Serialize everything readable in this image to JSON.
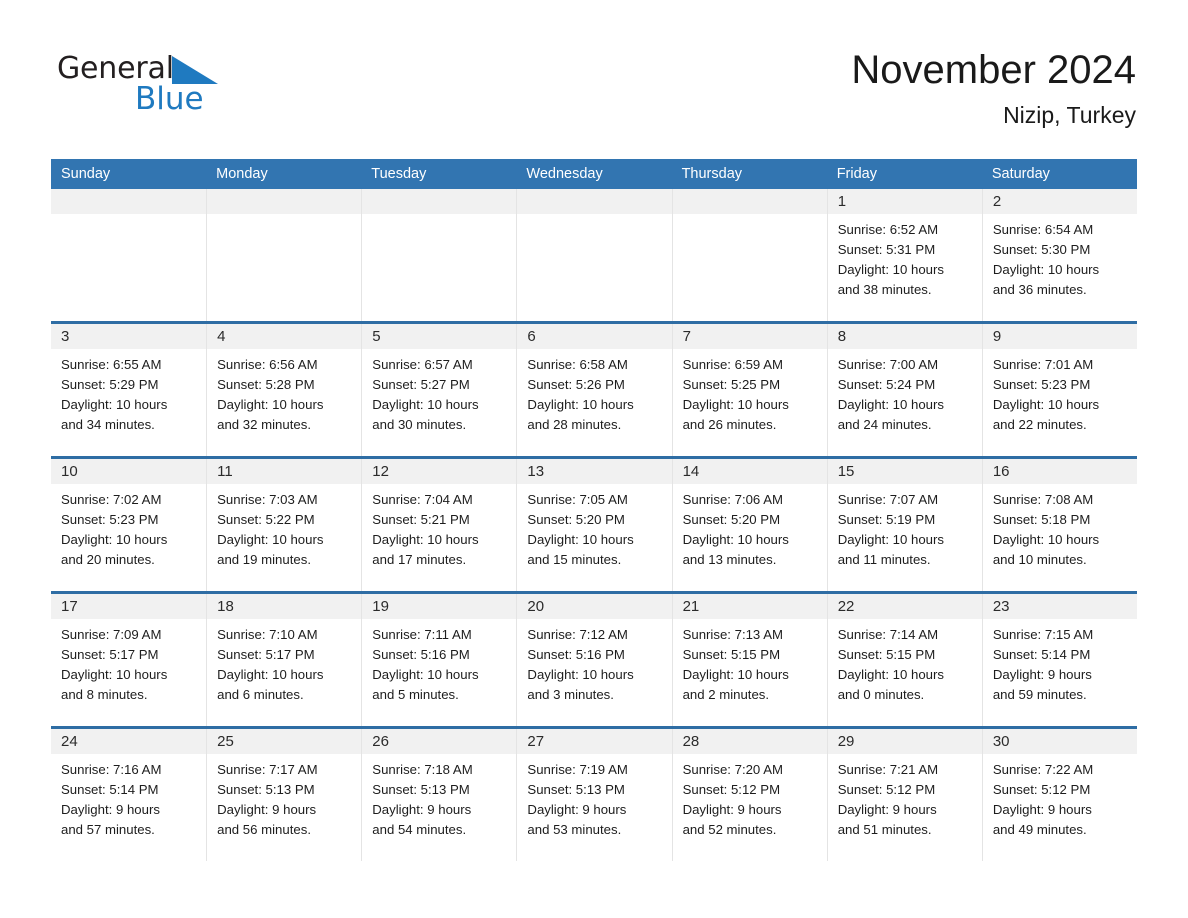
{
  "brand": {
    "name_part1": "General",
    "name_part2": "Blue",
    "triangle_color": "#1f7ac0"
  },
  "header": {
    "title": "November 2024",
    "subtitle": "Nizip, Turkey"
  },
  "theme": {
    "header_blue": "#3275b1",
    "week_divider_blue": "#2e6da4",
    "day_band_gray": "#f1f1f1",
    "text_color": "#1d1d1d"
  },
  "weekdays": [
    "Sunday",
    "Monday",
    "Tuesday",
    "Wednesday",
    "Thursday",
    "Friday",
    "Saturday"
  ],
  "weeks": [
    [
      {
        "empty": true
      },
      {
        "empty": true
      },
      {
        "empty": true
      },
      {
        "empty": true
      },
      {
        "empty": true
      },
      {
        "day": "1",
        "sunrise": "Sunrise: 6:52 AM",
        "sunset": "Sunset: 5:31 PM",
        "daylight1": "Daylight: 10 hours",
        "daylight2": "and 38 minutes."
      },
      {
        "day": "2",
        "sunrise": "Sunrise: 6:54 AM",
        "sunset": "Sunset: 5:30 PM",
        "daylight1": "Daylight: 10 hours",
        "daylight2": "and 36 minutes."
      }
    ],
    [
      {
        "day": "3",
        "sunrise": "Sunrise: 6:55 AM",
        "sunset": "Sunset: 5:29 PM",
        "daylight1": "Daylight: 10 hours",
        "daylight2": "and 34 minutes."
      },
      {
        "day": "4",
        "sunrise": "Sunrise: 6:56 AM",
        "sunset": "Sunset: 5:28 PM",
        "daylight1": "Daylight: 10 hours",
        "daylight2": "and 32 minutes."
      },
      {
        "day": "5",
        "sunrise": "Sunrise: 6:57 AM",
        "sunset": "Sunset: 5:27 PM",
        "daylight1": "Daylight: 10 hours",
        "daylight2": "and 30 minutes."
      },
      {
        "day": "6",
        "sunrise": "Sunrise: 6:58 AM",
        "sunset": "Sunset: 5:26 PM",
        "daylight1": "Daylight: 10 hours",
        "daylight2": "and 28 minutes."
      },
      {
        "day": "7",
        "sunrise": "Sunrise: 6:59 AM",
        "sunset": "Sunset: 5:25 PM",
        "daylight1": "Daylight: 10 hours",
        "daylight2": "and 26 minutes."
      },
      {
        "day": "8",
        "sunrise": "Sunrise: 7:00 AM",
        "sunset": "Sunset: 5:24 PM",
        "daylight1": "Daylight: 10 hours",
        "daylight2": "and 24 minutes."
      },
      {
        "day": "9",
        "sunrise": "Sunrise: 7:01 AM",
        "sunset": "Sunset: 5:23 PM",
        "daylight1": "Daylight: 10 hours",
        "daylight2": "and 22 minutes."
      }
    ],
    [
      {
        "day": "10",
        "sunrise": "Sunrise: 7:02 AM",
        "sunset": "Sunset: 5:23 PM",
        "daylight1": "Daylight: 10 hours",
        "daylight2": "and 20 minutes."
      },
      {
        "day": "11",
        "sunrise": "Sunrise: 7:03 AM",
        "sunset": "Sunset: 5:22 PM",
        "daylight1": "Daylight: 10 hours",
        "daylight2": "and 19 minutes."
      },
      {
        "day": "12",
        "sunrise": "Sunrise: 7:04 AM",
        "sunset": "Sunset: 5:21 PM",
        "daylight1": "Daylight: 10 hours",
        "daylight2": "and 17 minutes."
      },
      {
        "day": "13",
        "sunrise": "Sunrise: 7:05 AM",
        "sunset": "Sunset: 5:20 PM",
        "daylight1": "Daylight: 10 hours",
        "daylight2": "and 15 minutes."
      },
      {
        "day": "14",
        "sunrise": "Sunrise: 7:06 AM",
        "sunset": "Sunset: 5:20 PM",
        "daylight1": "Daylight: 10 hours",
        "daylight2": "and 13 minutes."
      },
      {
        "day": "15",
        "sunrise": "Sunrise: 7:07 AM",
        "sunset": "Sunset: 5:19 PM",
        "daylight1": "Daylight: 10 hours",
        "daylight2": "and 11 minutes."
      },
      {
        "day": "16",
        "sunrise": "Sunrise: 7:08 AM",
        "sunset": "Sunset: 5:18 PM",
        "daylight1": "Daylight: 10 hours",
        "daylight2": "and 10 minutes."
      }
    ],
    [
      {
        "day": "17",
        "sunrise": "Sunrise: 7:09 AM",
        "sunset": "Sunset: 5:17 PM",
        "daylight1": "Daylight: 10 hours",
        "daylight2": "and 8 minutes."
      },
      {
        "day": "18",
        "sunrise": "Sunrise: 7:10 AM",
        "sunset": "Sunset: 5:17 PM",
        "daylight1": "Daylight: 10 hours",
        "daylight2": "and 6 minutes."
      },
      {
        "day": "19",
        "sunrise": "Sunrise: 7:11 AM",
        "sunset": "Sunset: 5:16 PM",
        "daylight1": "Daylight: 10 hours",
        "daylight2": "and 5 minutes."
      },
      {
        "day": "20",
        "sunrise": "Sunrise: 7:12 AM",
        "sunset": "Sunset: 5:16 PM",
        "daylight1": "Daylight: 10 hours",
        "daylight2": "and 3 minutes."
      },
      {
        "day": "21",
        "sunrise": "Sunrise: 7:13 AM",
        "sunset": "Sunset: 5:15 PM",
        "daylight1": "Daylight: 10 hours",
        "daylight2": "and 2 minutes."
      },
      {
        "day": "22",
        "sunrise": "Sunrise: 7:14 AM",
        "sunset": "Sunset: 5:15 PM",
        "daylight1": "Daylight: 10 hours",
        "daylight2": "and 0 minutes."
      },
      {
        "day": "23",
        "sunrise": "Sunrise: 7:15 AM",
        "sunset": "Sunset: 5:14 PM",
        "daylight1": "Daylight: 9 hours",
        "daylight2": "and 59 minutes."
      }
    ],
    [
      {
        "day": "24",
        "sunrise": "Sunrise: 7:16 AM",
        "sunset": "Sunset: 5:14 PM",
        "daylight1": "Daylight: 9 hours",
        "daylight2": "and 57 minutes."
      },
      {
        "day": "25",
        "sunrise": "Sunrise: 7:17 AM",
        "sunset": "Sunset: 5:13 PM",
        "daylight1": "Daylight: 9 hours",
        "daylight2": "and 56 minutes."
      },
      {
        "day": "26",
        "sunrise": "Sunrise: 7:18 AM",
        "sunset": "Sunset: 5:13 PM",
        "daylight1": "Daylight: 9 hours",
        "daylight2": "and 54 minutes."
      },
      {
        "day": "27",
        "sunrise": "Sunrise: 7:19 AM",
        "sunset": "Sunset: 5:13 PM",
        "daylight1": "Daylight: 9 hours",
        "daylight2": "and 53 minutes."
      },
      {
        "day": "28",
        "sunrise": "Sunrise: 7:20 AM",
        "sunset": "Sunset: 5:12 PM",
        "daylight1": "Daylight: 9 hours",
        "daylight2": "and 52 minutes."
      },
      {
        "day": "29",
        "sunrise": "Sunrise: 7:21 AM",
        "sunset": "Sunset: 5:12 PM",
        "daylight1": "Daylight: 9 hours",
        "daylight2": "and 51 minutes."
      },
      {
        "day": "30",
        "sunrise": "Sunrise: 7:22 AM",
        "sunset": "Sunset: 5:12 PM",
        "daylight1": "Daylight: 9 hours",
        "daylight2": "and 49 minutes."
      }
    ]
  ]
}
